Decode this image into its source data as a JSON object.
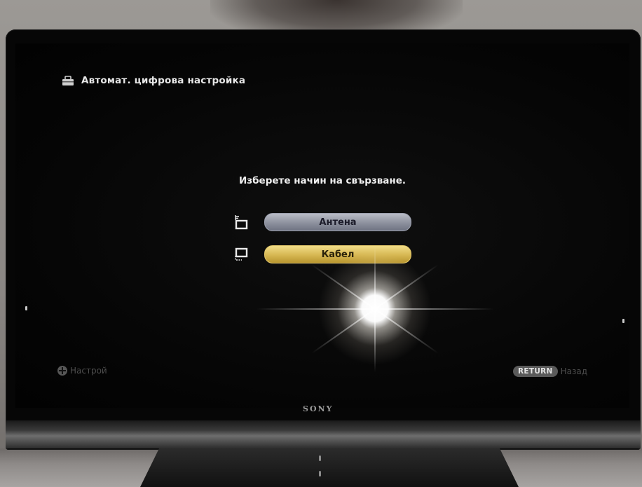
{
  "header": {
    "title": "Автомат. цифрова настройка",
    "icon": "toolbox-icon"
  },
  "prompt": "Изберете начин на свързване.",
  "options": [
    {
      "label": "Антена",
      "icon": "antenna-icon",
      "color": "#8d919e",
      "selected": false
    },
    {
      "label": "Кабел",
      "icon": "cable-icon",
      "color": "#d6b752",
      "selected": true
    }
  ],
  "footer": {
    "left_label": "Настрой",
    "left_icon": "dpad-icon",
    "return_badge": "RETURN",
    "back_label": "Назад"
  },
  "brand": "SONY",
  "colors": {
    "screen_bg": "#050505",
    "selected_accent": "#d6b752"
  }
}
